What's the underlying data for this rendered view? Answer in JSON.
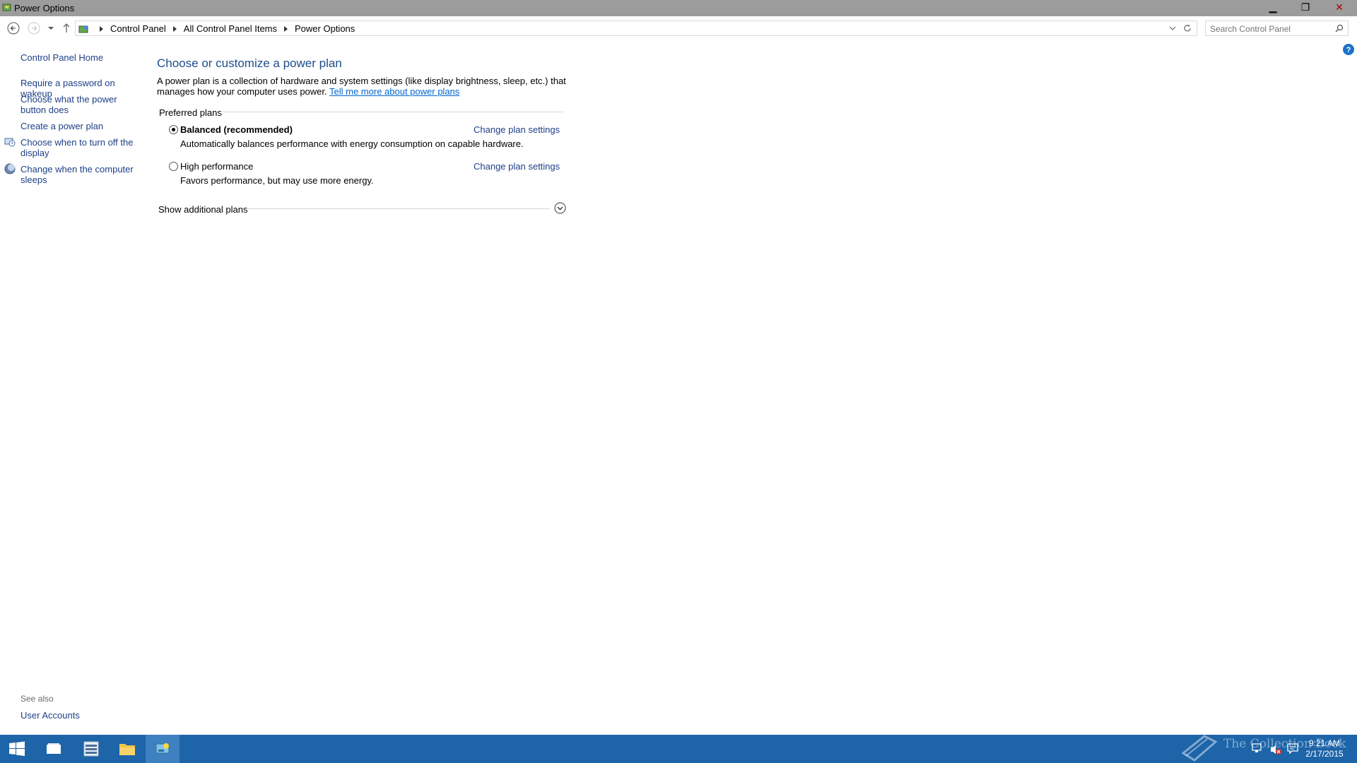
{
  "window": {
    "title": "Power Options",
    "minimize_glyph": "▁",
    "maximize_glyph": "❐",
    "close_glyph": "✕"
  },
  "address_bar": {
    "crumbs": [
      "Control Panel",
      "All Control Panel Items",
      "Power Options"
    ]
  },
  "search": {
    "placeholder": "Search Control Panel"
  },
  "sidebar": {
    "items": [
      {
        "label": "Control Panel Home"
      },
      {
        "label": "Require a password on wakeup"
      },
      {
        "label": "Choose what the power button does"
      },
      {
        "label": "Create a power plan"
      },
      {
        "label": "Choose when to turn off the display",
        "icon": "monitor-clock-icon"
      },
      {
        "label": "Change when the computer sleeps",
        "icon": "moon-icon"
      }
    ],
    "see_also_title": "See also",
    "see_also_link": "User Accounts"
  },
  "main": {
    "title": "Choose or customize a power plan",
    "intro_text": "A power plan is a collection of hardware and system settings (like display brightness, sleep, etc.) that manages how your computer uses power. ",
    "intro_link": "Tell me more about power plans",
    "group_label": "Preferred plans",
    "plans": [
      {
        "name": "Balanced (recommended)",
        "selected": true,
        "description": "Automatically balances performance with energy consumption on capable hardware.",
        "link": "Change plan settings"
      },
      {
        "name": "High performance",
        "selected": false,
        "description": "Favors performance, but may use more energy.",
        "link": "Change plan settings"
      }
    ],
    "show_additional": "Show additional plans"
  },
  "taskbar": {
    "color": "#1d64a8",
    "items": [
      "start-icon",
      "task-view-icon",
      "server-manager-icon",
      "file-explorer-icon",
      "control-panel-icon"
    ],
    "clock_time": "9:21 AM",
    "clock_date": "2/17/2015",
    "watermark": "The Collection Book"
  },
  "colors": {
    "link": "#1e3f86",
    "title": "#1e4d8c",
    "titlebar": "#9c9c9c"
  }
}
